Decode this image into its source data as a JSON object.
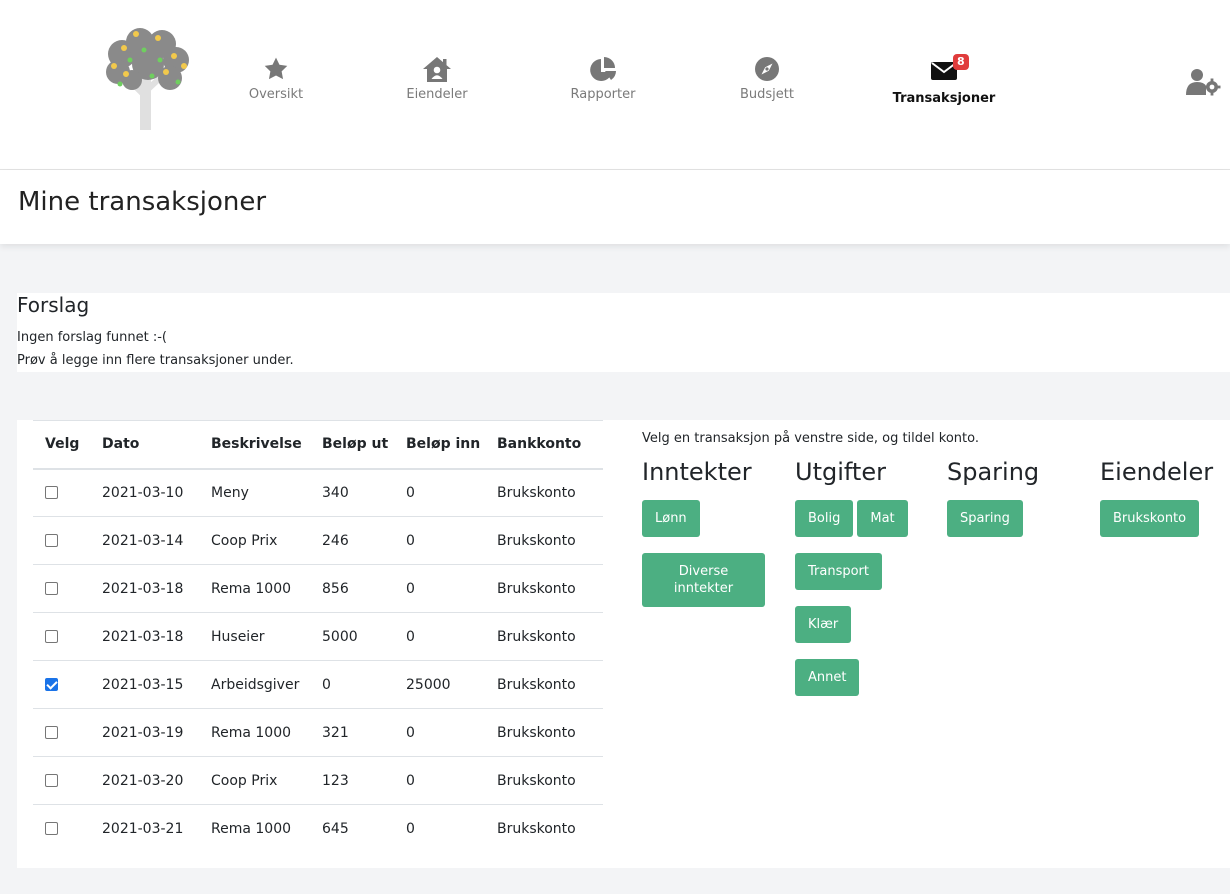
{
  "nav": {
    "items": [
      {
        "label": "Oversikt",
        "icon": "star-icon"
      },
      {
        "label": "Eiendeler",
        "icon": "house-user-icon"
      },
      {
        "label": "Rapporter",
        "icon": "pie-chart-icon"
      },
      {
        "label": "Budsjett",
        "icon": "compass-icon"
      },
      {
        "label": "Transaksjoner",
        "icon": "envelope-icon",
        "active": true,
        "badge": "8"
      }
    ],
    "user_icon": "user-cog-icon"
  },
  "page": {
    "title": "Mine transaksjoner"
  },
  "suggestions": {
    "title": "Forslag",
    "line1": "Ingen forslag funnet :-(",
    "line2": "Prøv å legge inn flere transaksjoner under."
  },
  "table": {
    "headers": [
      "Velg",
      "Dato",
      "Beskrivelse",
      "Beløp ut",
      "Beløp inn",
      "Bankkonto"
    ],
    "rows": [
      {
        "checked": false,
        "date": "2021-03-10",
        "desc": "Meny",
        "out": "340",
        "in": "0",
        "account": "Brukskonto"
      },
      {
        "checked": false,
        "date": "2021-03-14",
        "desc": "Coop Prix",
        "out": "246",
        "in": "0",
        "account": "Brukskonto"
      },
      {
        "checked": false,
        "date": "2021-03-18",
        "desc": "Rema 1000",
        "out": "856",
        "in": "0",
        "account": "Brukskonto"
      },
      {
        "checked": false,
        "date": "2021-03-18",
        "desc": "Huseier",
        "out": "5000",
        "in": "0",
        "account": "Brukskonto"
      },
      {
        "checked": true,
        "date": "2021-03-15",
        "desc": "Arbeidsgiver",
        "out": "0",
        "in": "25000",
        "account": "Brukskonto"
      },
      {
        "checked": false,
        "date": "2021-03-19",
        "desc": "Rema 1000",
        "out": "321",
        "in": "0",
        "account": "Brukskonto"
      },
      {
        "checked": false,
        "date": "2021-03-20",
        "desc": "Coop Prix",
        "out": "123",
        "in": "0",
        "account": "Brukskonto"
      },
      {
        "checked": false,
        "date": "2021-03-21",
        "desc": "Rema 1000",
        "out": "645",
        "in": "0",
        "account": "Brukskonto"
      }
    ]
  },
  "assign": {
    "hint": "Velg en transaksjon på venstre side, og tildel konto.",
    "income": {
      "title": "Inntekter",
      "buttons": [
        "Lønn",
        "Diverse inntekter"
      ]
    },
    "expenses": {
      "title": "Utgifter",
      "buttons": [
        "Bolig",
        "Mat",
        "Transport",
        "Klær",
        "Annet"
      ]
    },
    "savings": {
      "title": "Sparing",
      "buttons": [
        "Sparing"
      ]
    },
    "assets": {
      "title": "Eiendeler",
      "buttons": [
        "Brukskonto"
      ]
    }
  },
  "colors": {
    "accent_button": "#4caf82",
    "badge": "#e03c3c",
    "icon_gray": "#7a7a7a"
  }
}
